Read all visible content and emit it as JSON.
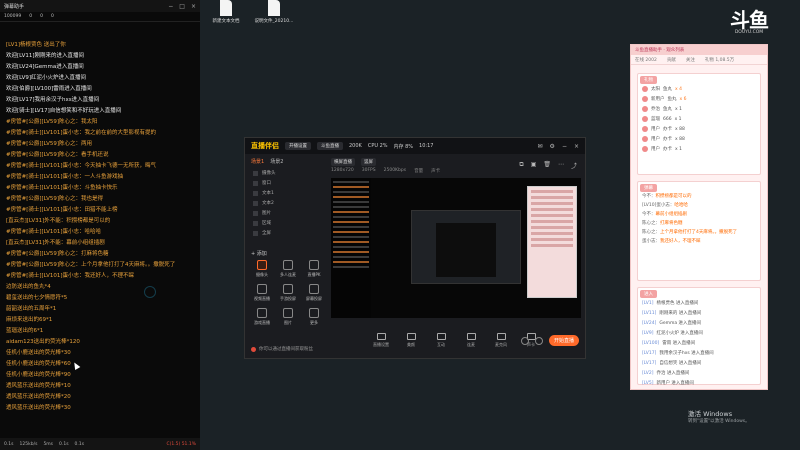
{
  "chat": {
    "title": "弹幕助手",
    "stats": [
      "100099",
      "0",
      "0",
      "0"
    ],
    "lines": [
      {
        "text": "[LV1]杨根贾色 送出了你",
        "color": "#e9a23b"
      },
      {
        "text": "欢迎[LV11]刚刚来的进入直播间",
        "color": "#e8e8e8"
      },
      {
        "text": "欢迎[LV24]Gemma进入直播间",
        "color": "#e8e8e8"
      },
      {
        "text": "欢迎[LV9]红泥小火炉进入直播间",
        "color": "#e8e8e8"
      },
      {
        "text": "欢迎[伯爵][LV100]雷雨进入直播间",
        "color": "#e8e8e8"
      },
      {
        "text": "欢迎[LV17]我用余汉子hxs进入直播间",
        "color": "#e8e8e8"
      },
      {
        "text": "欢迎[骑士][LV17]自信想笑和不好玩进入直播间",
        "color": "#e8e8e8"
      },
      {
        "text": "#房管#[公爵][LV59]陈心之：我太阳",
        "color": "#e9a23b"
      },
      {
        "text": "#房管#[骑士][LV101]蛋小志：我之前在前的大型影视有提的",
        "color": "#e9a23b"
      },
      {
        "text": "#房管#[公爵][LV59]陈心之：两用",
        "color": "#e9a23b"
      },
      {
        "text": "#房管#[公爵][LV59]陈心之：看手机还说",
        "color": "#e9a23b"
      },
      {
        "text": "#房管#[骑士][LV101]蛋小志：今天抽卡飞德一无所获，晦气",
        "color": "#e9a23b"
      },
      {
        "text": "#房管#[骑士][LV101]蛋小志：一人斗鱼游戏抽",
        "color": "#e9a23b"
      },
      {
        "text": "#房管#[骑士][LV101]蛋小志：斗鱼抽卡快乐",
        "color": "#e9a23b"
      },
      {
        "text": "#房管#[公爵][LV59]陈心之：我也是得",
        "color": "#e9a23b"
      },
      {
        "text": "#房管#[骑士][LV101]蛋小志：田猎不能上榜",
        "color": "#e9a23b"
      },
      {
        "text": "[直云杰][LV31]外不能：积攒榜都是可以的",
        "color": "#e9a23b"
      },
      {
        "text": "#房管#[骑士][LV101]蛋小志：哈哈哈",
        "color": "#e9a23b"
      },
      {
        "text": "[直云杰][LV31]外不能：幕前小组组插剧",
        "color": "#e9a23b"
      },
      {
        "text": "#房管#[公爵][LV59]陈心之：打麻将色糖",
        "color": "#e9a23b"
      },
      {
        "text": "#房管#[公爵][LV59]陈心之：上个月拿他打打了4天麻将。。撒脱死了",
        "color": "#e9a23b"
      },
      {
        "text": "#房管#[骑士][LV101]蛋小志：我还好人，不理不睬",
        "color": "#e9a23b"
      },
      {
        "text": "边防送出的鱼丸*4",
        "color": "#e9a23b"
      },
      {
        "text": "碧玺送出的七夕情愿符*5",
        "color": "#e9a23b"
      },
      {
        "text": "韶韶送出的五周年*1",
        "color": "#e9a23b"
      },
      {
        "text": "麻烦来送出的69*1",
        "color": "#e9a23b"
      },
      {
        "text": "蓝瑙送出的6*1",
        "color": "#e9a23b"
      },
      {
        "text": "aidam123送出的荧光棒*120",
        "color": "#e9a23b"
      },
      {
        "text": "佳机小鹿送出的荧光棒*30",
        "color": "#e9a23b"
      },
      {
        "text": "佳机小鹿送出的荧光棒*60",
        "color": "#e9a23b"
      },
      {
        "text": "佳机小鹿送出的荧光棒*90",
        "color": "#e9a23b"
      },
      {
        "text": "透风蓝乐送出的荧光棒*10",
        "color": "#e9a23b"
      },
      {
        "text": "透风蓝乐送出的荧光棒*20",
        "color": "#e9a23b"
      },
      {
        "text": "透风蓝乐送出的荧光棒*30",
        "color": "#e9a23b"
      }
    ],
    "footer": [
      "0.1s",
      "125kb/s",
      "5ms",
      "0.1s",
      "0.1s",
      "C(1.5) 51.1%"
    ]
  },
  "desktop": {
    "files": [
      {
        "name": "新建文本文档"
      },
      {
        "name": "说明文件_20210..."
      }
    ]
  },
  "douyu": {
    "logo": "斗鱼",
    "domain": "DOUYU.COM"
  },
  "app": {
    "logo": "直播伴侣",
    "top_buttons": [
      "开播设置",
      "斗鱼直播"
    ],
    "status": [
      "200K",
      "CPU 2%",
      "内存 8%",
      "10:17"
    ],
    "tabs": [
      {
        "label": "场景1",
        "active": true
      },
      {
        "label": "场景2",
        "active": false
      }
    ],
    "scenes": [
      "摄像头",
      "窗口",
      "文本1",
      "文本2",
      "图片",
      "区域",
      "全屏"
    ],
    "add_scene": "+ 添加",
    "tools": [
      "摄像头",
      "多人连麦",
      "直播PK",
      "视频直播",
      "手游投屏",
      "屏幕投屏",
      "游戏直播",
      "图片",
      "更多"
    ],
    "preview_header": [
      "横屏直播",
      "竖屏"
    ],
    "preview_sub": [
      "1280x720",
      "30FPS",
      "2500Kbps",
      "音量",
      "声卡"
    ],
    "bottom_note": "你可以通过直播间获取粉丝",
    "controls": [
      "直播设置",
      "美颜",
      "互动",
      "连麦",
      "麦克风",
      "声卡"
    ],
    "start_label": "开始直播"
  },
  "panel": {
    "header": "斗鱼直播助手 · 观众列表",
    "stats": [
      "在线 2002",
      "贡献",
      "关注",
      "礼物 1,08.5万"
    ],
    "gift_section_badge": "礼物",
    "gifts": [
      {
        "user": "太阳",
        "item": "鱼丸",
        "count": "x 4",
        "orange": true
      },
      {
        "user": "新用户",
        "item": "鱼丸",
        "count": "x 6",
        "orange": true
      },
      {
        "user": "乔治",
        "item": "鱼丸",
        "count": "x 1",
        "orange": false
      },
      {
        "user": "蓝瑙",
        "item": "666",
        "count": "x 1",
        "orange": false
      },
      {
        "user": "用户",
        "item": "办卡",
        "count": "x 88",
        "orange": false
      },
      {
        "user": "用户",
        "item": "办卡",
        "count": "x 88",
        "orange": false
      },
      {
        "user": "用户",
        "item": "办卡",
        "count": "x 1",
        "orange": false
      }
    ],
    "chat_section_badge": "弹幕",
    "msgs": [
      {
        "pre": "今不：",
        "hl": "积攒榜都是可以的"
      },
      {
        "pre": "[LV10]蛋小志：",
        "hl": "哈哈哈"
      },
      {
        "pre": "今不：",
        "hl": "幕前小组组插剧"
      },
      {
        "pre": "陈心之：",
        "hl": "打麻将色糖"
      },
      {
        "pre": "陈心之：",
        "hl": "上个月拿他打打了4天麻将。。撒脱死了"
      },
      {
        "pre": "蛋小志：",
        "hl": "我还好人，不理不睬"
      }
    ],
    "enter_section_badge": "进入",
    "enters": [
      {
        "lv": "[LV1]",
        "text": "杨根贾色  进入直播间"
      },
      {
        "lv": "[LV11]",
        "text": "刚刚来的 进入直播间"
      },
      {
        "lv": "[LV24]",
        "text": "Gemma 进入直播间"
      },
      {
        "lv": "[LV9]",
        "text": "红泥小火炉 进入直播间"
      },
      {
        "lv": "[LV100]",
        "text": "雷雨 进入直播间"
      },
      {
        "lv": "[LV17]",
        "text": "我用余汉子hxs 进入直播间"
      },
      {
        "lv": "[LV17]",
        "text": "自信想笑 进入直播间"
      },
      {
        "lv": "[LV2]",
        "text": "乔治 进入直播间"
      },
      {
        "lv": "[LV5]",
        "text": "新用户 进入直播间"
      }
    ]
  },
  "activate": {
    "line1": "激活 Windows",
    "line2": "转到\"设置\"以激活 Windows。"
  },
  "colors": {
    "accent": "#ff6a2a",
    "chat_orange": "#e9a23b",
    "panel_pink": "#fff1f1"
  }
}
